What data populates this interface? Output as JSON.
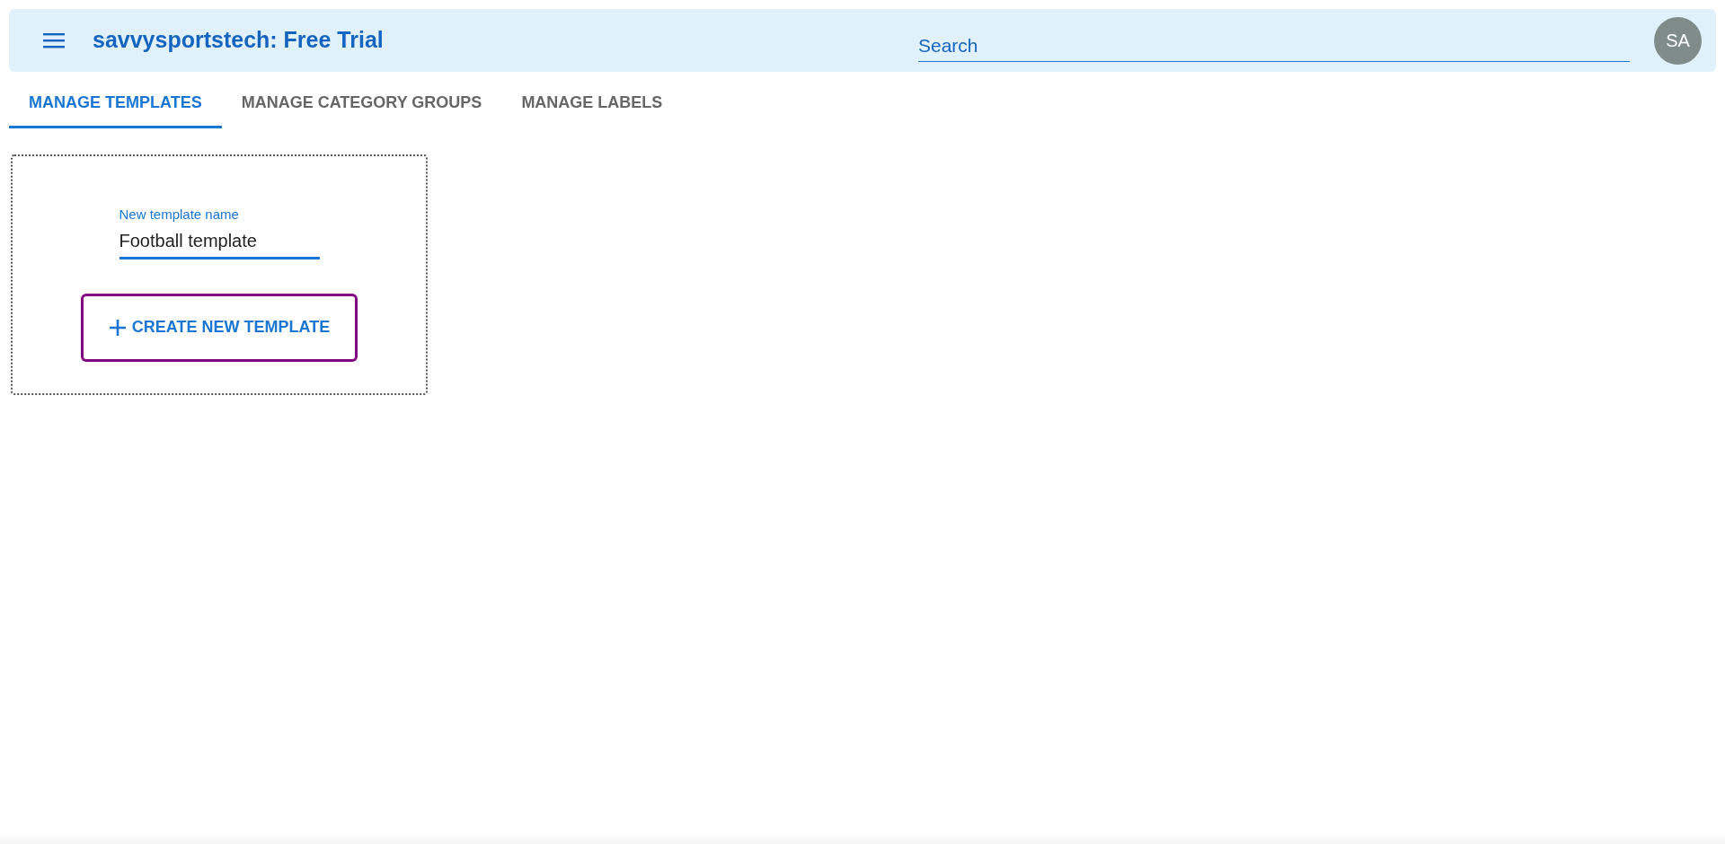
{
  "app_bar": {
    "title": "savvysportstech: Free Trial",
    "search": {
      "placeholder": "Search"
    },
    "avatar": "SA"
  },
  "tabs": [
    {
      "label": "MANAGE TEMPLATES",
      "selected": true
    },
    {
      "label": "MANAGE CATEGORY GROUPS",
      "selected": false
    },
    {
      "label": "MANAGE LABELS",
      "selected": false
    }
  ],
  "form": {
    "field": {
      "label": "New template name",
      "value": "Football template",
      "focused": true
    },
    "button": {
      "label": "CREATE NEW TEMPLATE",
      "focused": true
    }
  }
}
